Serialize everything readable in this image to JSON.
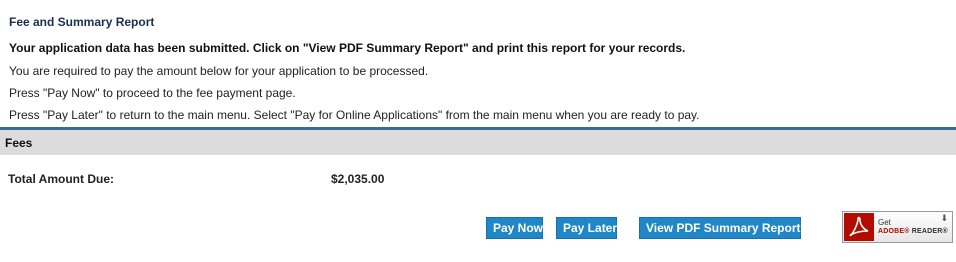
{
  "report": {
    "title": "Fee and Summary Report",
    "submitted_message": "Your application data has been submitted. Click on \"View PDF Summary Report\" and print this report for your records.",
    "pay_required": "You are required to pay the amount below for your application to be processed.",
    "pay_now_info": "Press \"Pay Now\" to proceed to the fee payment page.",
    "pay_later_info": "Press \"Pay Later\" to return to the main menu. Select \"Pay for Online Applications\" from the main menu when you are ready to pay."
  },
  "fees": {
    "section_label": "Fees",
    "total_label": "Total Amount Due:",
    "total_value": "$2,035.00"
  },
  "actions": {
    "pay_now": "Pay Now",
    "pay_later": "Pay Later",
    "view_pdf": "View PDF Summary Report"
  },
  "adobe_badge": {
    "get_text": "Get",
    "brand_text": "ADOBE®",
    "product_text": "READER®",
    "icon": "adobe-reader-icon"
  },
  "colors": {
    "title": "#1a2f52",
    "divider": "#3a6a9c",
    "section_bar": "#dcdcdc",
    "button": "#1f86c7",
    "adobe_red": "#b30b00"
  }
}
